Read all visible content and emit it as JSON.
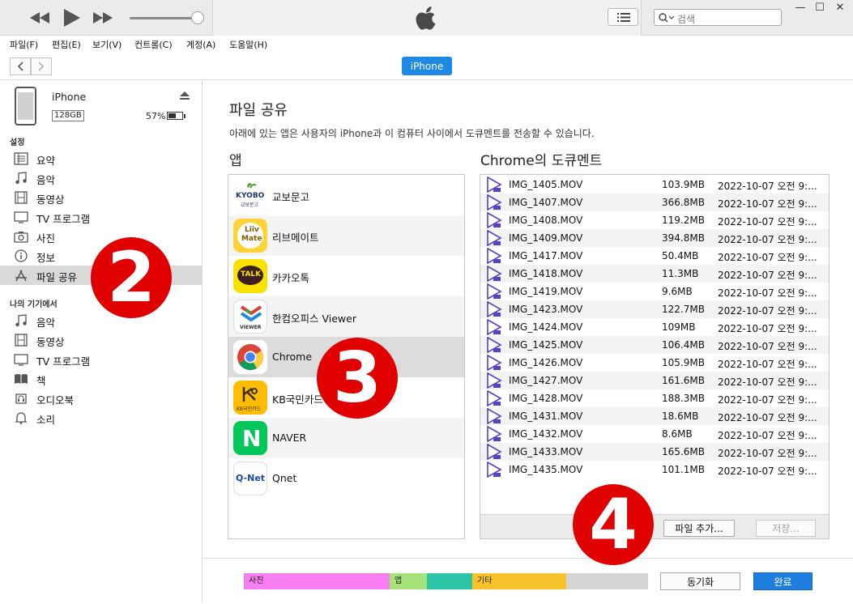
{
  "search": {
    "placeholder": "검색"
  },
  "menu": [
    "파일(F)",
    "편집(E)",
    "보기(V)",
    "컨트롤(C)",
    "계정(A)",
    "도움말(H)"
  ],
  "device_tab": "iPhone",
  "device": {
    "name": "iPhone",
    "capacity": "128GB",
    "battery": "57%",
    "battery_level": 0.57
  },
  "sidebar": {
    "settings_title": "설정",
    "settings_items": [
      {
        "label": "요약",
        "icon": "summary-icon"
      },
      {
        "label": "음악",
        "icon": "music-note-icon"
      },
      {
        "label": "동영상",
        "icon": "film-icon"
      },
      {
        "label": "TV 프로그램",
        "icon": "tv-icon"
      },
      {
        "label": "사진",
        "icon": "camera-icon"
      },
      {
        "label": "정보",
        "icon": "info-icon"
      },
      {
        "label": "파일 공유",
        "icon": "app-store-icon",
        "selected": true
      }
    ],
    "device_title": "나의 기기에서",
    "device_items": [
      {
        "label": "음악",
        "icon": "music-note-icon"
      },
      {
        "label": "동영상",
        "icon": "film-icon"
      },
      {
        "label": "TV 프로그램",
        "icon": "tv-icon"
      },
      {
        "label": "책",
        "icon": "book-icon"
      },
      {
        "label": "오디오북",
        "icon": "audiobook-icon"
      },
      {
        "label": "소리",
        "icon": "bell-icon"
      }
    ]
  },
  "main": {
    "title": "파일 공유",
    "description": "아래에 있는 앱은 사용자의 iPhone과 이 컴퓨터 사이에서 도큐멘트를 전송할 수 있습니다.",
    "apps_title": "앱",
    "docs_title": "Chrome의 도큐멘트",
    "apps": [
      {
        "name": "교보문고",
        "icon": "kyobo-icon",
        "icon_text": "KYOBO",
        "icon_sub": "교보문고"
      },
      {
        "name": "리브메이트",
        "icon": "liivmate-icon",
        "icon_text": "Liiv",
        "icon_sub": "Mate"
      },
      {
        "name": "카카오톡",
        "icon": "kakaotalk-icon",
        "icon_text": "TALK"
      },
      {
        "name": "한컴오피스 Viewer",
        "icon": "hancom-viewer-icon",
        "icon_text": "VIEWER"
      },
      {
        "name": "Chrome",
        "icon": "chrome-icon",
        "selected": true
      },
      {
        "name": "KB국민카드",
        "icon": "kb-card-icon",
        "icon_text": "KB국민카드"
      },
      {
        "name": "NAVER",
        "icon": "naver-icon",
        "icon_text": "N"
      },
      {
        "name": "Qnet",
        "icon": "qnet-icon",
        "icon_text": "Q-Net"
      }
    ],
    "documents": [
      {
        "name": "IMG_1405.MOV",
        "size": "103.9MB",
        "date": "2022-10-07 오전 9:..."
      },
      {
        "name": "IMG_1407.MOV",
        "size": "366.8MB",
        "date": "2022-10-07 오전 9:..."
      },
      {
        "name": "IMG_1408.MOV",
        "size": "119.2MB",
        "date": "2022-10-07 오전 9:..."
      },
      {
        "name": "IMG_1409.MOV",
        "size": "394.8MB",
        "date": "2022-10-07 오전 9:..."
      },
      {
        "name": "IMG_1417.MOV",
        "size": "50.4MB",
        "date": "2022-10-07 오전 9:..."
      },
      {
        "name": "IMG_1418.MOV",
        "size": "11.3MB",
        "date": "2022-10-07 오전 9:..."
      },
      {
        "name": "IMG_1419.MOV",
        "size": "9.6MB",
        "date": "2022-10-07 오전 9:..."
      },
      {
        "name": "IMG_1423.MOV",
        "size": "122.7MB",
        "date": "2022-10-07 오전 9:..."
      },
      {
        "name": "IMG_1424.MOV",
        "size": "109MB",
        "date": "2022-10-07 오전 9:..."
      },
      {
        "name": "IMG_1425.MOV",
        "size": "106.4MB",
        "date": "2022-10-07 오전 9:..."
      },
      {
        "name": "IMG_1426.MOV",
        "size": "105.9MB",
        "date": "2022-10-07 오전 9:..."
      },
      {
        "name": "IMG_1427.MOV",
        "size": "161.6MB",
        "date": "2022-10-07 오전 9:..."
      },
      {
        "name": "IMG_1428.MOV",
        "size": "188.3MB",
        "date": "2022-10-07 오전 9:..."
      },
      {
        "name": "IMG_1431.MOV",
        "size": "18.6MB",
        "date": "2022-10-07 오전 9:..."
      },
      {
        "name": "IMG_1432.MOV",
        "size": "8.6MB",
        "date": "2022-10-07 오전 9:..."
      },
      {
        "name": "IMG_1433.MOV",
        "size": "165.6MB",
        "date": "2022-10-07 오전 9:..."
      },
      {
        "name": "IMG_1435.MOV",
        "size": "101.1MB",
        "date": "2022-10-07 오전 9:..."
      }
    ],
    "add_file_label": "파일 추가...",
    "save_label": "저장..."
  },
  "storage": [
    {
      "label": "사진",
      "color": "#f77ef0"
    },
    {
      "label": "앱",
      "color": "#a5e37a"
    },
    {
      "label": "",
      "color": "#2ec4a6"
    },
    {
      "label": "기타",
      "color": "#f6c42a"
    },
    {
      "label": "",
      "color": "#d4d4d4"
    }
  ],
  "sync_label": "동기화",
  "done_label": "완료",
  "annotations": [
    "2",
    "3",
    "4"
  ]
}
